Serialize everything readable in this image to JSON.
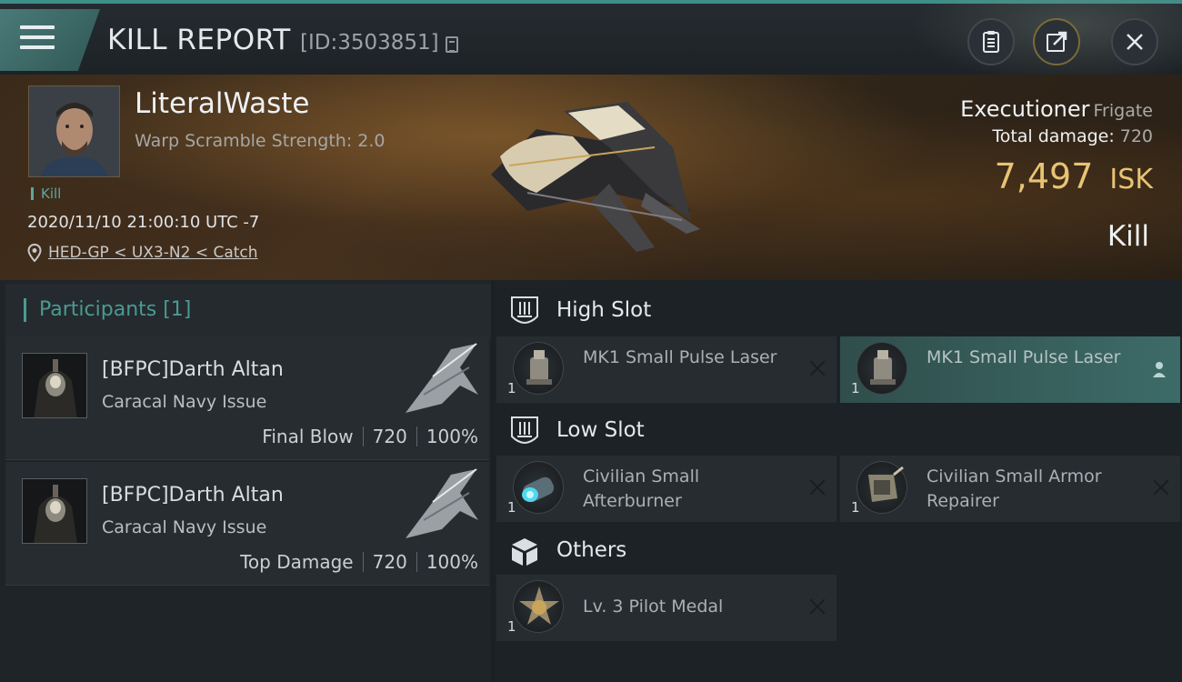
{
  "header": {
    "title": "KILL REPORT",
    "report_id": "[ID:3503851]",
    "buttons": [
      "clipboard-icon",
      "share-icon",
      "close-icon"
    ]
  },
  "victim": {
    "name": "LiteralWaste",
    "warp_scramble": "Warp Scramble Strength: 2.0",
    "tag": "Kill",
    "datetime": "2020/11/10 21:00:10 UTC -7",
    "location": "HED-GP < UX3-N2 < Catch"
  },
  "ship": {
    "name": "Executioner",
    "class": "Frigate",
    "total_damage_label": "Total damage:",
    "total_damage": "720",
    "isk_value": "7,497",
    "isk_unit": "ISK",
    "result": "Kill"
  },
  "participants": {
    "title": "Participants [1]",
    "rows": [
      {
        "name": "[BFPC]Darth Altan",
        "ship": "Caracal Navy Issue",
        "role": "Final Blow",
        "damage": "720",
        "percent": "100%"
      },
      {
        "name": "[BFPC]Darth Altan",
        "ship": "Caracal Navy Issue",
        "role": "Top Damage",
        "damage": "720",
        "percent": "100%"
      }
    ]
  },
  "slots": {
    "high": {
      "label": "High Slot",
      "modules": [
        {
          "name": "MK1 Small Pulse Laser",
          "count": "1"
        },
        {
          "name": "MK1 Small Pulse Laser",
          "count": "1"
        }
      ]
    },
    "low": {
      "label": "Low Slot",
      "modules": [
        {
          "name": "Civilian Small Afterburner",
          "count": "1"
        },
        {
          "name": "Civilian Small Armor Repairer",
          "count": "1"
        }
      ]
    },
    "others": {
      "label": "Others",
      "modules": [
        {
          "name": "Lv. 3 Pilot Medal",
          "count": "1"
        }
      ]
    }
  },
  "colors": {
    "accent": "#4b9a93",
    "isk": "#e7c373",
    "active_module": "#3d6b68"
  }
}
